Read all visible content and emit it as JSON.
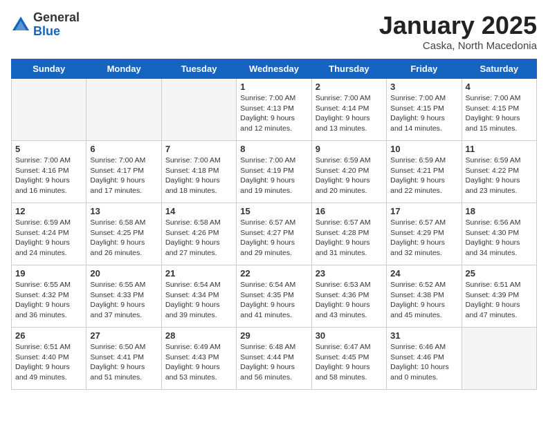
{
  "header": {
    "logo_general": "General",
    "logo_blue": "Blue",
    "month_title": "January 2025",
    "location": "Caska, North Macedonia"
  },
  "weekdays": [
    "Sunday",
    "Monday",
    "Tuesday",
    "Wednesday",
    "Thursday",
    "Friday",
    "Saturday"
  ],
  "weeks": [
    [
      {
        "day": "",
        "empty": true
      },
      {
        "day": "",
        "empty": true
      },
      {
        "day": "",
        "empty": true
      },
      {
        "day": "1",
        "sunrise": "7:00 AM",
        "sunset": "4:13 PM",
        "daylight": "9 hours and 12 minutes."
      },
      {
        "day": "2",
        "sunrise": "7:00 AM",
        "sunset": "4:14 PM",
        "daylight": "9 hours and 13 minutes."
      },
      {
        "day": "3",
        "sunrise": "7:00 AM",
        "sunset": "4:15 PM",
        "daylight": "9 hours and 14 minutes."
      },
      {
        "day": "4",
        "sunrise": "7:00 AM",
        "sunset": "4:15 PM",
        "daylight": "9 hours and 15 minutes."
      }
    ],
    [
      {
        "day": "5",
        "sunrise": "7:00 AM",
        "sunset": "4:16 PM",
        "daylight": "9 hours and 16 minutes."
      },
      {
        "day": "6",
        "sunrise": "7:00 AM",
        "sunset": "4:17 PM",
        "daylight": "9 hours and 17 minutes."
      },
      {
        "day": "7",
        "sunrise": "7:00 AM",
        "sunset": "4:18 PM",
        "daylight": "9 hours and 18 minutes."
      },
      {
        "day": "8",
        "sunrise": "7:00 AM",
        "sunset": "4:19 PM",
        "daylight": "9 hours and 19 minutes."
      },
      {
        "day": "9",
        "sunrise": "6:59 AM",
        "sunset": "4:20 PM",
        "daylight": "9 hours and 20 minutes."
      },
      {
        "day": "10",
        "sunrise": "6:59 AM",
        "sunset": "4:21 PM",
        "daylight": "9 hours and 22 minutes."
      },
      {
        "day": "11",
        "sunrise": "6:59 AM",
        "sunset": "4:22 PM",
        "daylight": "9 hours and 23 minutes."
      }
    ],
    [
      {
        "day": "12",
        "sunrise": "6:59 AM",
        "sunset": "4:24 PM",
        "daylight": "9 hours and 24 minutes."
      },
      {
        "day": "13",
        "sunrise": "6:58 AM",
        "sunset": "4:25 PM",
        "daylight": "9 hours and 26 minutes."
      },
      {
        "day": "14",
        "sunrise": "6:58 AM",
        "sunset": "4:26 PM",
        "daylight": "9 hours and 27 minutes."
      },
      {
        "day": "15",
        "sunrise": "6:57 AM",
        "sunset": "4:27 PM",
        "daylight": "9 hours and 29 minutes."
      },
      {
        "day": "16",
        "sunrise": "6:57 AM",
        "sunset": "4:28 PM",
        "daylight": "9 hours and 31 minutes."
      },
      {
        "day": "17",
        "sunrise": "6:57 AM",
        "sunset": "4:29 PM",
        "daylight": "9 hours and 32 minutes."
      },
      {
        "day": "18",
        "sunrise": "6:56 AM",
        "sunset": "4:30 PM",
        "daylight": "9 hours and 34 minutes."
      }
    ],
    [
      {
        "day": "19",
        "sunrise": "6:55 AM",
        "sunset": "4:32 PM",
        "daylight": "9 hours and 36 minutes."
      },
      {
        "day": "20",
        "sunrise": "6:55 AM",
        "sunset": "4:33 PM",
        "daylight": "9 hours and 37 minutes."
      },
      {
        "day": "21",
        "sunrise": "6:54 AM",
        "sunset": "4:34 PM",
        "daylight": "9 hours and 39 minutes."
      },
      {
        "day": "22",
        "sunrise": "6:54 AM",
        "sunset": "4:35 PM",
        "daylight": "9 hours and 41 minutes."
      },
      {
        "day": "23",
        "sunrise": "6:53 AM",
        "sunset": "4:36 PM",
        "daylight": "9 hours and 43 minutes."
      },
      {
        "day": "24",
        "sunrise": "6:52 AM",
        "sunset": "4:38 PM",
        "daylight": "9 hours and 45 minutes."
      },
      {
        "day": "25",
        "sunrise": "6:51 AM",
        "sunset": "4:39 PM",
        "daylight": "9 hours and 47 minutes."
      }
    ],
    [
      {
        "day": "26",
        "sunrise": "6:51 AM",
        "sunset": "4:40 PM",
        "daylight": "9 hours and 49 minutes."
      },
      {
        "day": "27",
        "sunrise": "6:50 AM",
        "sunset": "4:41 PM",
        "daylight": "9 hours and 51 minutes."
      },
      {
        "day": "28",
        "sunrise": "6:49 AM",
        "sunset": "4:43 PM",
        "daylight": "9 hours and 53 minutes."
      },
      {
        "day": "29",
        "sunrise": "6:48 AM",
        "sunset": "4:44 PM",
        "daylight": "9 hours and 56 minutes."
      },
      {
        "day": "30",
        "sunrise": "6:47 AM",
        "sunset": "4:45 PM",
        "daylight": "9 hours and 58 minutes."
      },
      {
        "day": "31",
        "sunrise": "6:46 AM",
        "sunset": "4:46 PM",
        "daylight": "10 hours and 0 minutes."
      },
      {
        "day": "",
        "empty": true
      }
    ]
  ]
}
